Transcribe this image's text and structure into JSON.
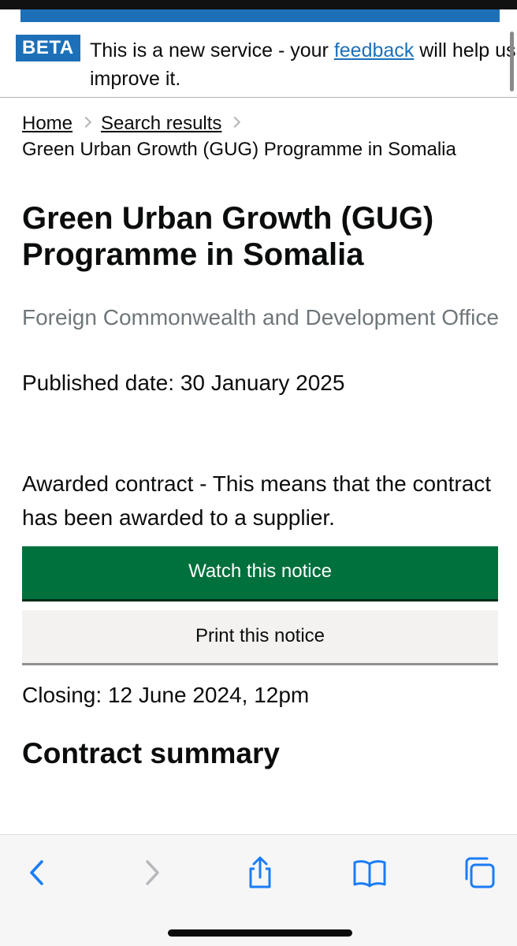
{
  "beta_banner": {
    "tag": "BETA",
    "text_before": "This is a new service - your ",
    "link_text": "feedback",
    "text_after": " will help us improve it."
  },
  "breadcrumbs": {
    "home": "Home",
    "search_results": "Search results",
    "current": "Green Urban Growth (GUG) Programme in Somalia"
  },
  "notice": {
    "title": "Green Urban Growth (GUG) Programme in Somalia",
    "organisation": "Foreign Commonwealth and Development Office",
    "published": "Published date: 30 January 2025",
    "status": "Awarded contract - This means that the contract has been awarded to a supplier.",
    "watch_label": "Watch this notice",
    "print_label": "Print this notice",
    "closing": "Closing: 12 June 2024, 12pm",
    "section_title": "Contract summary"
  },
  "browser_toolbar": {
    "icons": [
      "back-icon",
      "forward-icon",
      "share-icon",
      "bookmarks-icon",
      "tabs-icon"
    ],
    "active_color": "#1a7cf5",
    "disabled_color": "#b8b8bd"
  }
}
